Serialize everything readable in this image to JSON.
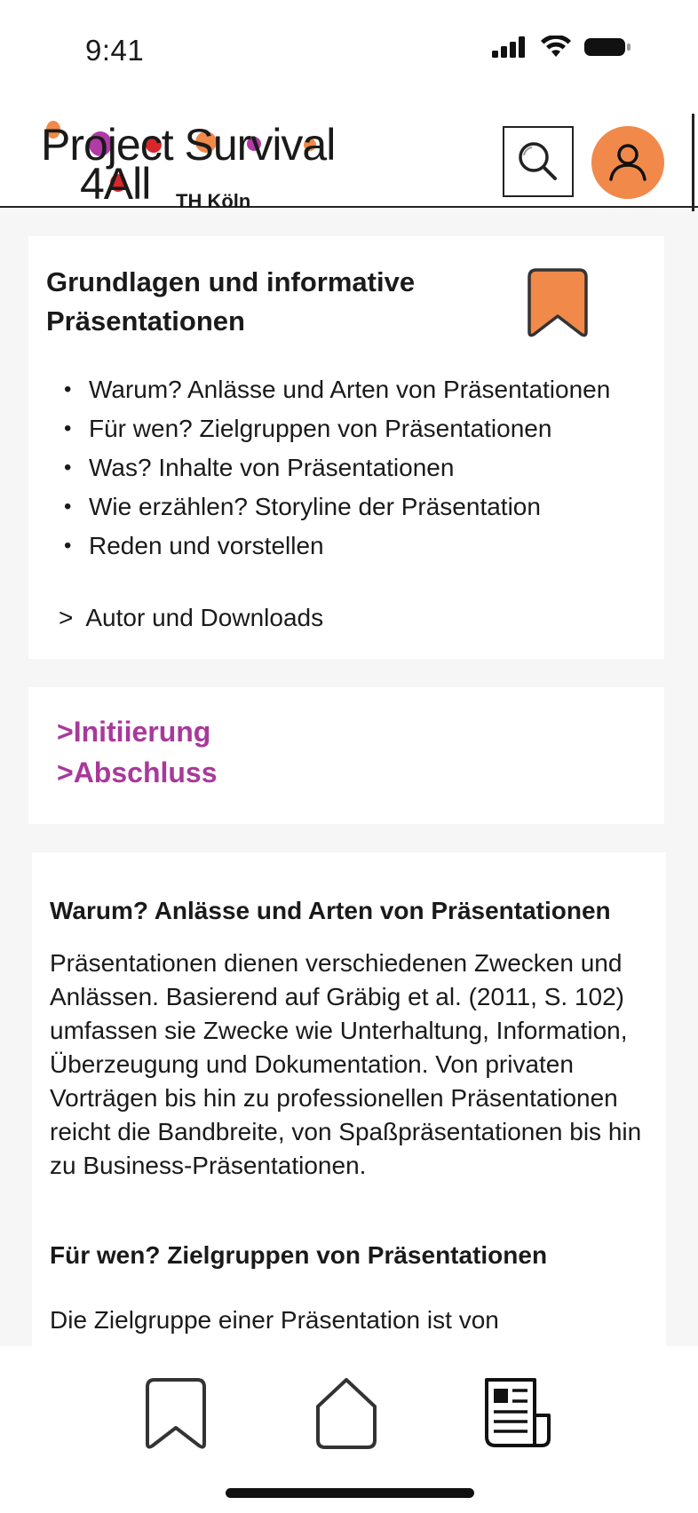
{
  "status": {
    "time": "9:41"
  },
  "header": {
    "logo_line1": "Project Survival",
    "logo_line2": "4All",
    "logo_sub": "TH Köln",
    "search_icon": "search-icon",
    "profile_icon": "user-icon"
  },
  "intro_card": {
    "title": "Grundlagen und informative Präsentationen",
    "bookmark_icon": "bookmark-icon",
    "topics": [
      "Warum? Anlässe und Arten von Präsentationen",
      "Für wen? Zielgruppen von Präsentationen",
      "Was? Inhalte von Präsentationen",
      "Wie erzählen? Storyline der Präsentation",
      "Reden und vorstellen"
    ],
    "author_chevron": ">",
    "author_link": "Autor und Downloads"
  },
  "phase_links": [
    {
      "label": ">Initiierung"
    },
    {
      "label": ">Abschluss"
    }
  ],
  "content": {
    "section1_title": "Warum? Anlässe und Arten von Präsentationen",
    "section1_body": "Präsentationen dienen verschiedenen Zwecken und Anlässen. Basierend auf Gräbig et al. (2011, S. 102) umfassen sie Zwecke wie Unterhaltung, Information, Überzeugung und Dokumentation. Von privaten Vorträgen bis hin zu professionellen Präsentationen reicht die Bandbreite, von Spaßpräsentationen bis hin zu Business-Präsentationen.",
    "section2_title": "Für wen? Zielgruppen von Präsentationen",
    "section2_body": "Die Zielgruppe einer Präsentation ist von"
  },
  "bottom_nav": {
    "items": [
      {
        "icon": "bookmark-icon"
      },
      {
        "icon": "home-icon"
      },
      {
        "icon": "newspaper-icon"
      }
    ]
  },
  "colors": {
    "accent_orange": "#f0894a",
    "link_magenta": "#a8399a",
    "logo_purple": "#b03aa6",
    "logo_red": "#d9262b"
  }
}
